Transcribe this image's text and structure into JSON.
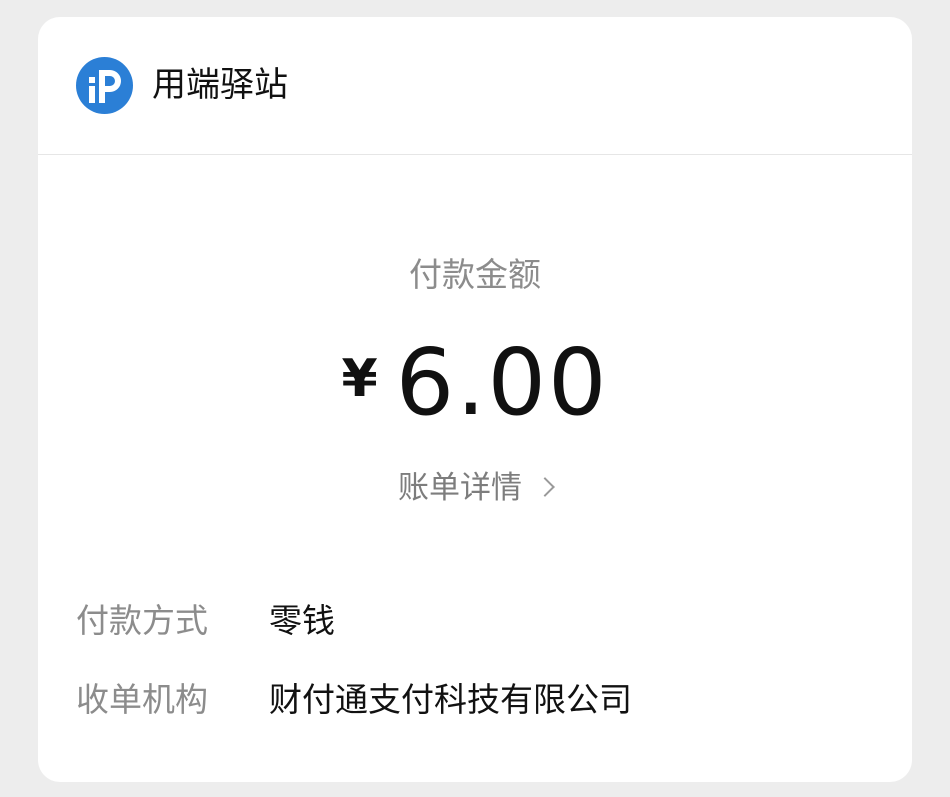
{
  "merchant": {
    "name": "用端驿站",
    "logo_icon": "p-logo-icon",
    "brand_color": "#2b7fd6"
  },
  "payment": {
    "amount_label": "付款金额",
    "currency_symbol": "¥",
    "amount": "6.00",
    "bill_detail_label": "账单详情"
  },
  "details": [
    {
      "label": "付款方式",
      "value": "零钱"
    },
    {
      "label": "收单机构",
      "value": "财付通支付科技有限公司"
    }
  ]
}
